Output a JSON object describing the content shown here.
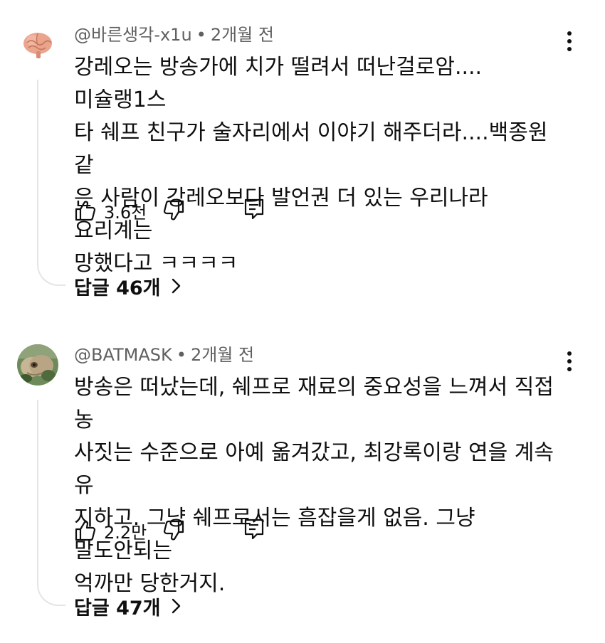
{
  "comments": [
    {
      "author": "@바른생각-x1u",
      "separator": "•",
      "time": "2개월 전",
      "text": "강레오는 방송가에 치가 떨려서 떠난걸로암....미슐랭1스\n타 쉐프 친구가 술자리에서 이야기 해주더라....백종원 같\n은 사람이 강레오보다 발언권 더 있는 우리나라 요리계는\n망했다고 ㅋㅋㅋㅋ",
      "likes": "3.6천",
      "replies": "답글 46개",
      "avatar_icon": "brain-icon"
    },
    {
      "author": "@BATMASK",
      "separator": "•",
      "time": "2개월 전",
      "text": "방송은 떠났는데, 쉐프로 재료의 중요성을 느껴서 직접 농\n사짓는 수준으로 아예 옮겨갔고, 최강록이랑 연을 계속 유\n지하고. 그냥 쉐프로서는 흠잡을게 없음. 그냥 말도안되는\n억까만 당한거지.",
      "likes": "2.2만",
      "replies": "답글 47개",
      "avatar_icon": "creature-photo-icon"
    }
  ],
  "icons": {
    "like": "thumbs-up-icon",
    "dislike": "thumbs-down-icon",
    "reply": "reply-icon",
    "menu": "more-vert-icon",
    "expand": "chevron-right-icon"
  },
  "colors": {
    "text": "#0f0f0f",
    "secondary": "#606060",
    "thread_line": "#e5e5e5"
  }
}
